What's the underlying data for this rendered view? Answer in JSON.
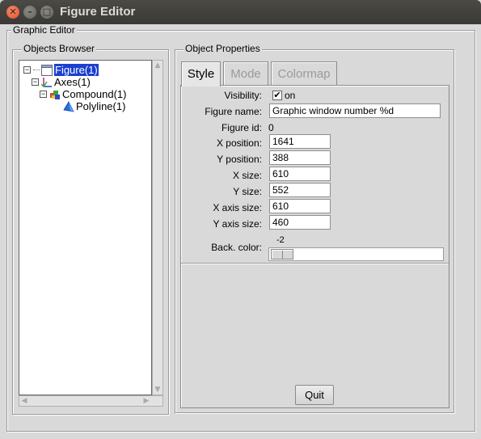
{
  "window": {
    "title": "Figure Editor",
    "close_glyph": "✕",
    "minimize_glyph": "–",
    "maximize_glyph": "□"
  },
  "graphic_editor": {
    "label": "Graphic Editor"
  },
  "objects_browser": {
    "label": "Objects Browser",
    "items": [
      {
        "label": "Figure(1)",
        "icon": "figure-window-icon",
        "expander": "−",
        "selected": true
      },
      {
        "label": "Axes(1)",
        "icon": "axes-icon",
        "expander": "−"
      },
      {
        "label": "Compound(1)",
        "icon": "compound-icon",
        "expander": "−"
      },
      {
        "label": "Polyline(1)",
        "icon": "polyline-icon"
      }
    ]
  },
  "object_properties": {
    "label": "Object Properties",
    "tabs": [
      {
        "label": "Style",
        "active": true
      },
      {
        "label": "Mode",
        "active": false
      },
      {
        "label": "Colormap",
        "active": false
      }
    ],
    "visibility": {
      "label": "Visibility:",
      "checked": true,
      "check_glyph": "✔",
      "value_label": "on"
    },
    "figure_name": {
      "label": "Figure name:",
      "value": "Graphic window number %d"
    },
    "figure_id": {
      "label": "Figure id:",
      "value": "0"
    },
    "x_position": {
      "label": "X position:",
      "value": "1641"
    },
    "y_position": {
      "label": "Y position:",
      "value": "388"
    },
    "x_size": {
      "label": "X size:",
      "value": "610"
    },
    "y_size": {
      "label": "Y size:",
      "value": "552"
    },
    "x_axis_size": {
      "label": "X axis size:",
      "value": "610"
    },
    "y_axis_size": {
      "label": "Y axis size:",
      "value": "460"
    },
    "back_color": {
      "label": "Back. color:",
      "value": "-2"
    },
    "quit_label": "Quit"
  }
}
